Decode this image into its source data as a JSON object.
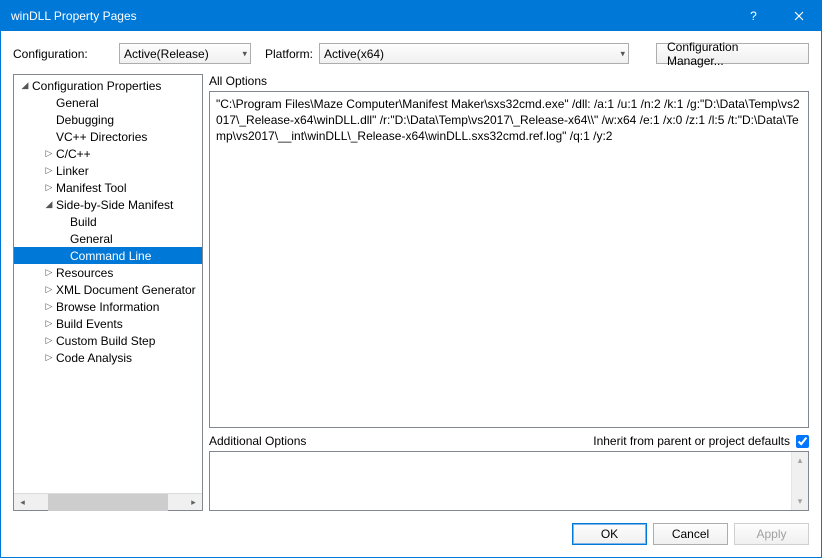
{
  "titlebar": {
    "title": "winDLL Property Pages"
  },
  "config_row": {
    "configuration_label": "Configuration:",
    "configuration_value": "Active(Release)",
    "platform_label": "Platform:",
    "platform_value": "Active(x64)",
    "config_manager_label": "Configuration Manager..."
  },
  "tree": {
    "root_label": "Configuration Properties",
    "items": {
      "general": "General",
      "debugging": "Debugging",
      "vcpp": "VC++ Directories",
      "ccpp": "C/C++",
      "linker": "Linker",
      "manifest_tool": "Manifest Tool",
      "sxs": "Side-by-Side Manifest",
      "sxs_build": "Build",
      "sxs_general": "General",
      "sxs_cmdline": "Command Line",
      "resources": "Resources",
      "xml_doc": "XML Document Generator",
      "browse_info": "Browse Information",
      "build_events": "Build Events",
      "custom_build": "Custom Build Step",
      "code_analysis": "Code Analysis"
    }
  },
  "right": {
    "all_options_label": "All Options",
    "all_options_text": "\"C:\\Program Files\\Maze Computer\\Manifest Maker\\sxs32cmd.exe\" /dll: /a:1 /u:1 /n:2 /k:1 /g:\"D:\\Data\\Temp\\vs2017\\_Release-x64\\winDLL.dll\" /r:\"D:\\Data\\Temp\\vs2017\\_Release-x64\\\\\" /w:x64 /e:1 /x:0 /z:1 /l:5 /t:\"D:\\Data\\Temp\\vs2017\\__int\\winDLL\\_Release-x64\\winDLL.sxs32cmd.ref.log\" /q:1 /y:2",
    "additional_options_label": "Additional Options",
    "inherit_label": "Inherit from parent or project defaults",
    "inherit_checked": true,
    "additional_options_value": ""
  },
  "buttons": {
    "ok": "OK",
    "cancel": "Cancel",
    "apply": "Apply"
  }
}
